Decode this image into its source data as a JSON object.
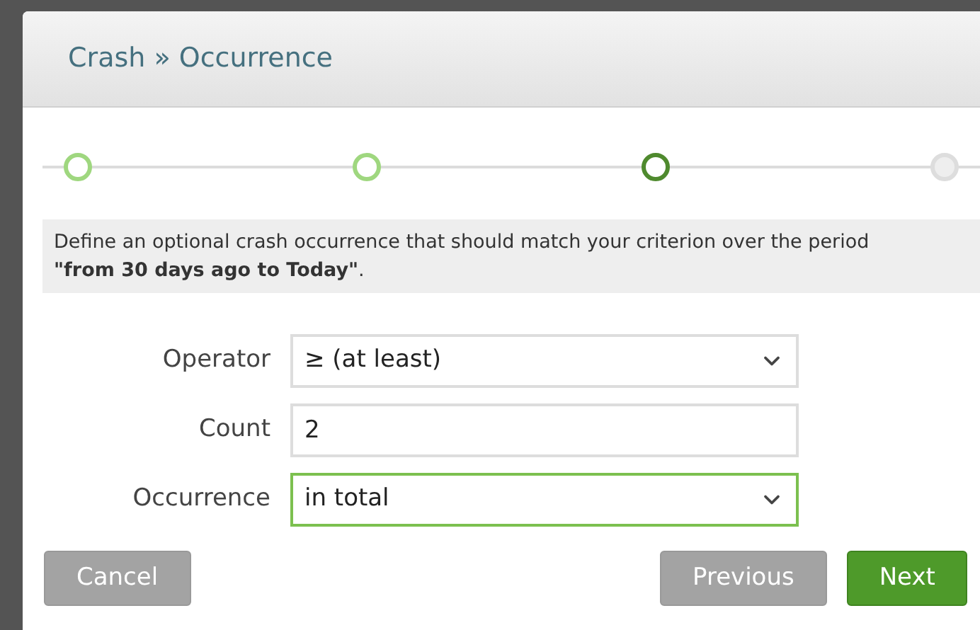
{
  "dialog": {
    "title": "Crash » Occurrence"
  },
  "steps": [
    {
      "kind": "done"
    },
    {
      "kind": "done"
    },
    {
      "kind": "current"
    },
    {
      "kind": "pending"
    }
  ],
  "description": "Define an optional crash occurrence that should match your criterion over the period **\"from 30 days ago to Today\"**.",
  "fields": [
    {
      "label": "Operator",
      "kind": "select",
      "value": "≥ (at least)",
      "focused": false
    },
    {
      "label": "Count",
      "kind": "input",
      "value": "2",
      "focused": false
    },
    {
      "label": "Occurrence",
      "kind": "select",
      "value": "in total",
      "focused": true
    }
  ],
  "buttons": [
    {
      "label": "Cancel",
      "kind": "secondary"
    },
    {
      "label": "Previous",
      "kind": "secondary"
    },
    {
      "label": "Next",
      "kind": "primary"
    }
  ]
}
